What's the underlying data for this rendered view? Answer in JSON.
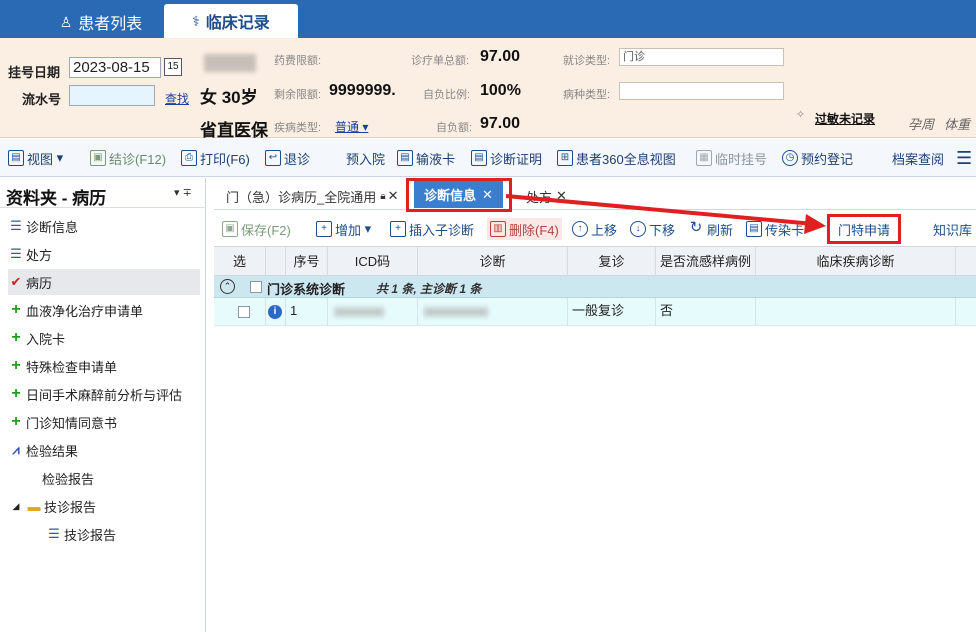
{
  "tabs": [
    {
      "label": "患者列表"
    },
    {
      "label": "临床记录"
    }
  ],
  "patient": {
    "reg_date_label": "挂号日期",
    "reg_date_value": "2023-08-15",
    "calendar_text": "15",
    "serial_label": "流水号",
    "serial_value": "",
    "lookup_link": "查找",
    "gender_age": "女 30岁",
    "insurance": "省直医保",
    "drug_limit_label": "药费限额:",
    "remaining_limit_label": "剩余限额:",
    "remaining_limit_value": "9999999.",
    "disease_type_label": "疾病类型:",
    "disease_type_value": "普通",
    "treatment_total_label": "诊疗单总额:",
    "treatment_total_value": "97.00",
    "self_ratio_label": "自负比例:",
    "self_ratio_value": "100%",
    "self_amount_label": "自负额:",
    "self_amount_value": "97.00",
    "visit_type_label": "就诊类型:",
    "visit_type_value": "门诊",
    "disease_kind_label": "病种类型:",
    "disease_kind_value": "",
    "allergy_link": "过敏未记录",
    "pregnancy_label": "孕周",
    "weight_label": "体重"
  },
  "toolbar": {
    "view": "视图",
    "finish": "结诊(F12)",
    "print": "打印(F6)",
    "back": "退诊",
    "pre_admit": "预入院",
    "infusion": "输液卡",
    "diag_cert": "诊断证明",
    "patient360": "患者360全息视图",
    "temp_reg": "临时挂号",
    "appointment": "预约登记",
    "archive": "档案查阅"
  },
  "left": {
    "title": "资料夹 - 病历",
    "pin": "▾ ∓",
    "items": [
      {
        "label": "诊断信息",
        "icon": "list-icon"
      },
      {
        "label": "处方",
        "icon": "list-icon"
      },
      {
        "label": "病历",
        "icon": "check-icon"
      },
      {
        "label": "血液净化治疗申请单",
        "icon": "plus-icon"
      },
      {
        "label": "入院卡",
        "icon": "plus-icon"
      },
      {
        "label": "特殊检查申请单",
        "icon": "plus-icon"
      },
      {
        "label": "日间手术麻醉前分析与评估",
        "icon": "plus-icon"
      },
      {
        "label": "门诊知情同意书",
        "icon": "plus-icon"
      },
      {
        "label": "检验结果",
        "icon": "chart-icon"
      },
      {
        "label": "检验报告",
        "icon": ""
      },
      {
        "label": "技诊报告",
        "icon": "folder-icon"
      },
      {
        "label": "技诊报告",
        "icon": "list-icon"
      }
    ]
  },
  "doctabs": {
    "record": "门（急）诊病历_全院通用",
    "diagnosis": "诊断信息",
    "prescription": "处方"
  },
  "actions": {
    "save": "保存(F2)",
    "add": "增加",
    "insert_sub": "插入子诊断",
    "delete": "删除(F4)",
    "up": "上移",
    "down": "下移",
    "refresh": "刷新",
    "infectious": "传染卡",
    "special_apply": "门特申请",
    "knowledge": "知识库"
  },
  "grid": {
    "columns": [
      "选",
      "序号",
      "ICD码",
      "诊断",
      "复诊",
      "是否流感样病例",
      "临床疾病诊断"
    ],
    "group_title": "门诊系统诊断",
    "group_summary": "共 1 条, 主诊断 1 条",
    "rows": [
      {
        "seq": "1",
        "revisit": "一般复诊",
        "flu": "否"
      }
    ]
  },
  "colors": {
    "tab_blue": "#2a6ab4",
    "highlight_red": "#e02020",
    "active_tab": "#3a7ecf"
  }
}
